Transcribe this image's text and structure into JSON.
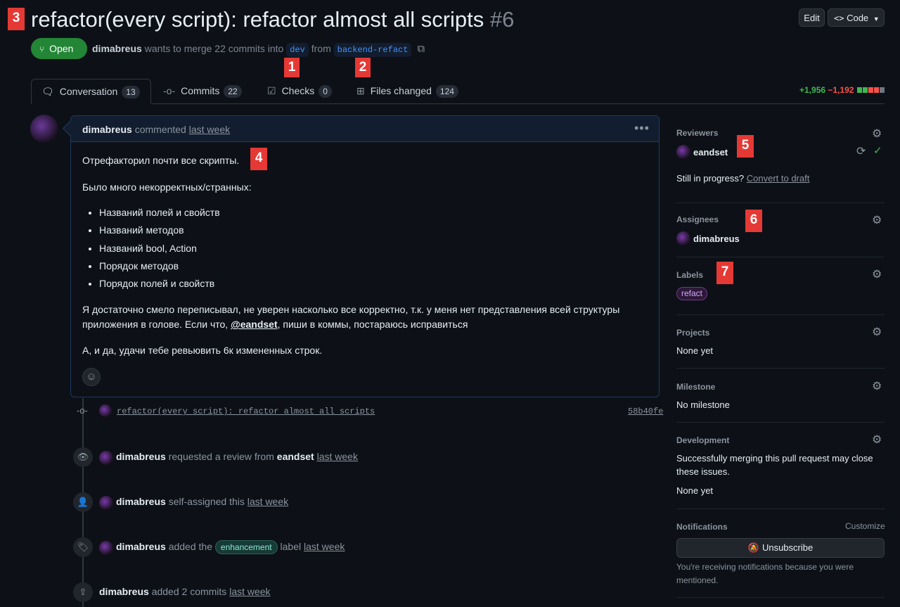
{
  "header": {
    "title": "refactor(every script): refactor almost all scripts",
    "number": "#6",
    "edit_label": "Edit",
    "code_label": "Code",
    "status": "Open",
    "author": "dimabreus",
    "merge_text_1": "wants to merge 22 commits into",
    "base_branch": "dev",
    "merge_text_2": "from",
    "head_branch": "backend-refact"
  },
  "badges": [
    "1",
    "2",
    "3",
    "4",
    "5",
    "6",
    "7"
  ],
  "tabs": [
    {
      "label": "Conversation",
      "count": "13"
    },
    {
      "label": "Commits",
      "count": "22"
    },
    {
      "label": "Checks",
      "count": "0"
    },
    {
      "label": "Files changed",
      "count": "124"
    }
  ],
  "diffstat": {
    "additions": "+1,956",
    "deletions": "−1,192"
  },
  "comment": {
    "author": "dimabreus",
    "verb": "commented",
    "time": "last week",
    "p1": "Отрефакторил почти все скрипты.",
    "p2": "Было много некорректных/странных:",
    "bullets": [
      "Названий полей и свойств",
      "Названий методов",
      "Названий bool, Action",
      "Порядок методов",
      "Порядок полей и свойств"
    ],
    "p3a": "Я достаточно смело переписывал, не уверен насколько все корректно, т.к. у меня нет представления всей структуры",
    "p3b_pre": "приложения в голове. Если что,",
    "mention": "@eandset",
    "p3b_post": ", пиши в коммы, постараюсь исправиться",
    "p4": "А, и да, удачи тебе ревьювить 6к измененных строк."
  },
  "timeline": {
    "commit_message": "refactor(every script): refactor almost all scripts",
    "commit_sha": "58b40fe",
    "review": {
      "actor": "dimabreus",
      "text": "requested a review from",
      "target": "eandset",
      "time": "last week"
    },
    "assign": {
      "actor": "dimabreus",
      "text": "self-assigned this",
      "time": "last week"
    },
    "label": {
      "actor": "dimabreus",
      "text": "added the",
      "label": "enhancement",
      "text2": "label",
      "time": "last week"
    },
    "commits": {
      "actor": "dimabreus",
      "text": "added 2 commits",
      "time": "last week"
    }
  },
  "sidebar": {
    "reviewers_title": "Reviewers",
    "reviewer": "eandset",
    "draft_text": "Still in progress?",
    "draft_link": "Convert to draft",
    "assignees_title": "Assignees",
    "assignee": "dimabreus",
    "labels_title": "Labels",
    "label": "refact",
    "projects_title": "Projects",
    "projects_value": "None yet",
    "milestone_title": "Milestone",
    "milestone_value": "No milestone",
    "development_title": "Development",
    "development_text": "Successfully merging this pull request may close these issues.",
    "development_value": "None yet",
    "notifications_title": "Notifications",
    "customize": "Customize",
    "unsubscribe": "Unsubscribe",
    "notif_reason": "You're receiving notifications because you were mentioned."
  },
  "colors": {
    "accent": "#4493f8",
    "open": "#238636",
    "badge": "#e53935",
    "add": "#3fb950",
    "del": "#f85149"
  }
}
